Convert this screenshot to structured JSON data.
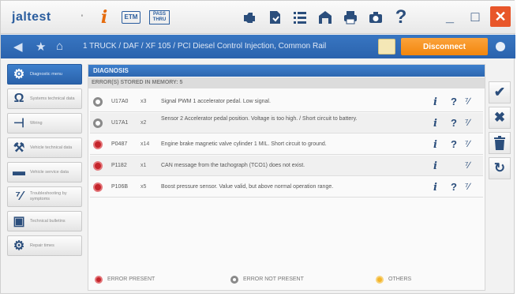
{
  "toolbar": {
    "logo": "jaltest",
    "tool_small_label": "ꞌ",
    "info_glyph": "i",
    "etm_label": "ETM",
    "pass_label": "PASS THRU",
    "help_glyph": "?",
    "icons": [
      "engine-icon",
      "document-icon",
      "list-icon",
      "garage-icon",
      "print-icon",
      "camera-icon"
    ],
    "minimize": "_",
    "maximize": "□",
    "close": "✕"
  },
  "nav": {
    "breadcrumb": "1 TRUCK / DAF / XF 105 / PCI Diesel Control Injection, Common Rail",
    "disconnect_label": "Disconnect"
  },
  "sidebar": {
    "items": [
      {
        "label": "Diagnostic menu",
        "icon": "diagnostic-icon"
      },
      {
        "label": "Systems technical data",
        "icon": "ohm-icon"
      },
      {
        "label": "Wiring",
        "icon": "wiring-icon"
      },
      {
        "label": "Vehicle technical data",
        "icon": "vehicle-data-icon"
      },
      {
        "label": "Vehicle service data",
        "icon": "service-icon"
      },
      {
        "label": "Troubleshooting by symptoms",
        "icon": "troubleshoot-icon"
      },
      {
        "label": "Technical bulletins",
        "icon": "bulletin-icon"
      },
      {
        "label": "Repair times",
        "icon": "repair-times-icon"
      }
    ]
  },
  "main": {
    "title": "DIAGNOSIS",
    "subtitle": "ERROR(S) STORED IN MEMORY: 5",
    "errors": [
      {
        "status": "not-present",
        "code": "U17A0",
        "count": "x3",
        "description": "Signal PWM 1 accelerator pedal. Low signal.",
        "has_help": true
      },
      {
        "status": "not-present",
        "code": "U17A1",
        "count": "x2",
        "description": "Sensor 2 Accelerator pedal position. Voltage is too high. / Short circuit to battery.",
        "has_help": true
      },
      {
        "status": "present",
        "code": "P0487",
        "count": "x14",
        "description": "Engine brake magnetic valve cylinder 1 MIL. Short circuit to ground.",
        "has_help": true
      },
      {
        "status": "present",
        "code": "P1182",
        "count": "x1",
        "description": "CAN message from the tachograph (TCO1) does not exist.",
        "has_help": false
      },
      {
        "status": "present",
        "code": "P106B",
        "count": "x5",
        "description": "Boost pressure sensor. Value valid, but above normal operation range.",
        "has_help": true
      }
    ],
    "action_info": "i",
    "action_help": "?",
    "action_tool": "⁷∕",
    "legend": {
      "present": "ERROR PRESENT",
      "not_present": "ERROR NOT PRESENT",
      "others": "OTHERS"
    }
  },
  "right_actions": {
    "confirm": "✔",
    "cancel": "✖",
    "delete": "🗑",
    "refresh": "↻"
  },
  "colors": {
    "accent_blue": "#2d67b0",
    "disconnect_orange": "#f3860d",
    "error_red": "#c4242b",
    "others_yellow": "#f3b52a",
    "close_red": "#e8562a"
  }
}
